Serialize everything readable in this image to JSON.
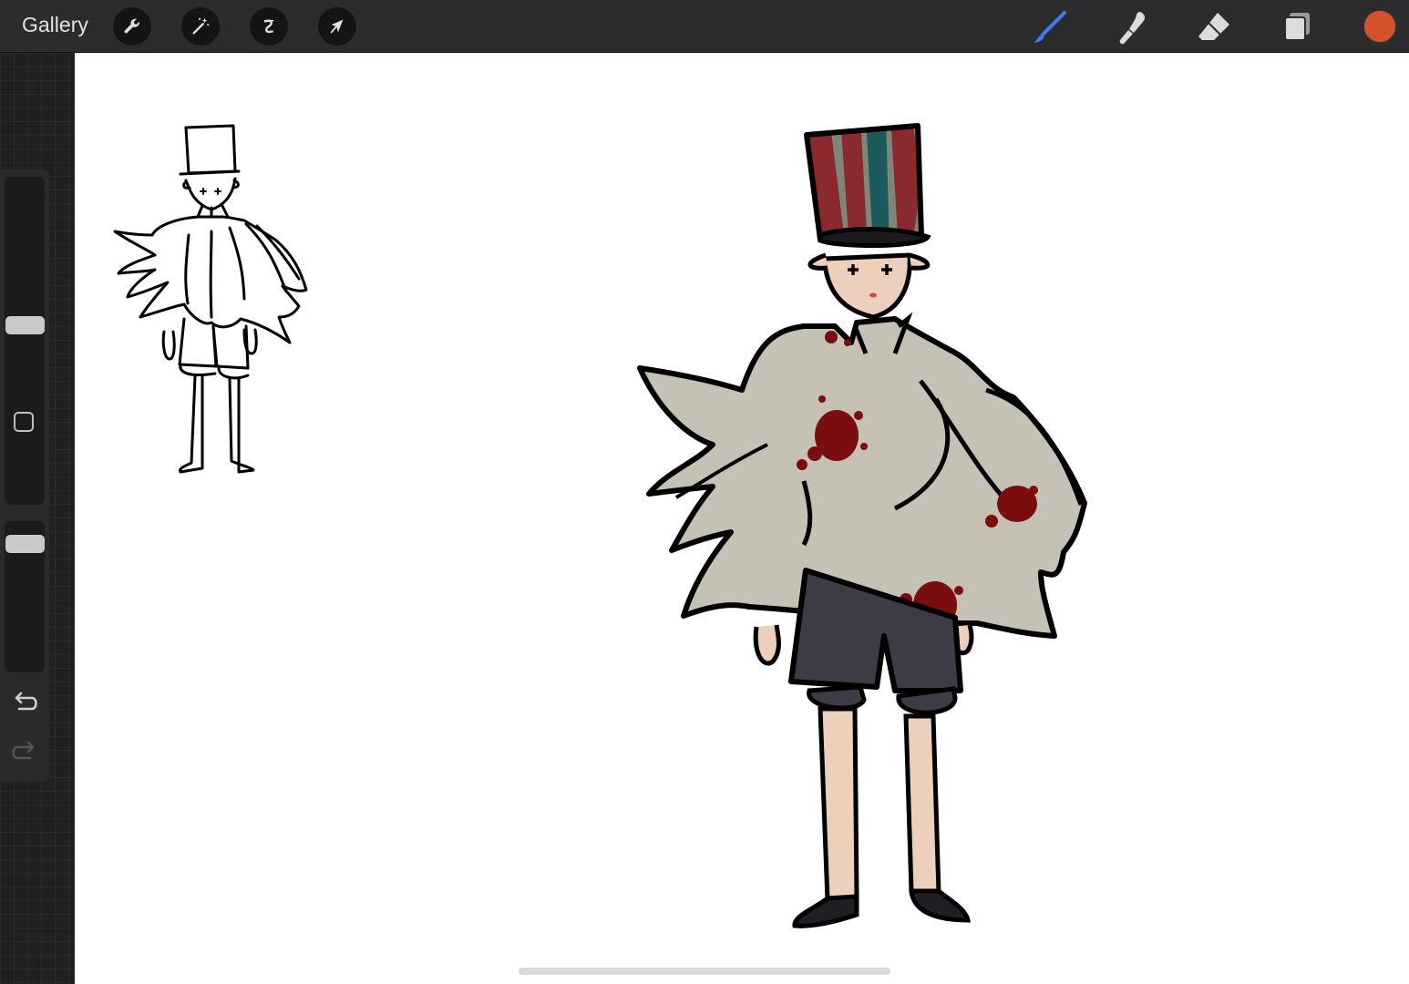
{
  "topbar": {
    "gallery_label": "Gallery",
    "left_tools": [
      "wrench-icon",
      "magic-wand-icon",
      "selection-s-icon",
      "transform-arrow-icon"
    ],
    "right_tools": [
      "brush-icon",
      "smudge-icon",
      "eraser-icon",
      "layers-icon"
    ],
    "active_tool": "brush-icon",
    "current_color": "#d4532a"
  },
  "sidebar": {
    "brush_size_level": 0.55,
    "opacity_level": 0.1,
    "buttons": [
      "modify-square-icon",
      "undo-icon",
      "redo-icon"
    ]
  },
  "colors": {
    "accent_blue": "#3b7cf2",
    "canvas": "#ffffff",
    "hat_stripes": [
      "#8b2a2e",
      "#7e8677",
      "#1c5a5c"
    ],
    "coat": "#c6c1b5",
    "blood": "#7a0d0d",
    "skin": "#ecd0bb",
    "shorts": "#3d3b45"
  }
}
